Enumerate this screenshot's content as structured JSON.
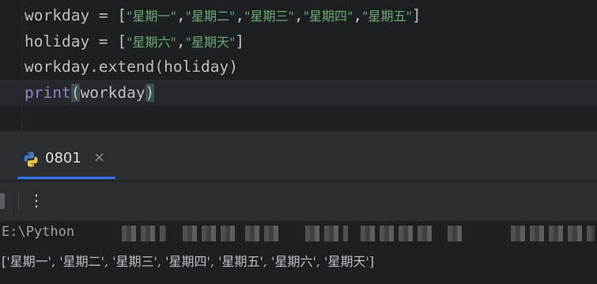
{
  "editor": {
    "lines": [
      {
        "var": "workday",
        "op": " = [",
        "items": [
          "\"星期一\"",
          ",",
          "\"星期二\"",
          ",",
          "\"星期三\"",
          ",",
          "\"星期四\"",
          ",",
          "\"星期五\""
        ],
        "close": "]"
      },
      {
        "var": "holiday",
        "op": " = [",
        "items": [
          "\"星期六\"",
          ",",
          "\"星期天\""
        ],
        "close": "]"
      },
      {
        "text": "workday.extend(holiday)"
      },
      {
        "builtin": "print",
        "open": "(",
        "arg": "workday",
        "close": ")"
      }
    ]
  },
  "run_panel": {
    "tab_label": "0801",
    "close_glyph": "×",
    "more_glyph": "⋮"
  },
  "console": {
    "path_partial": "E:\\Python",
    "output": "['星期一', '星期二', '星期三', '星期四', '星期五', '星期六', '星期天']"
  },
  "colors": {
    "editor_bg": "#1e1f22",
    "panel_bg": "#2b2d30",
    "string": "#6aab73",
    "builtin": "#8888c6",
    "text": "#bcbec4",
    "tab_underline": "#3574f0"
  }
}
